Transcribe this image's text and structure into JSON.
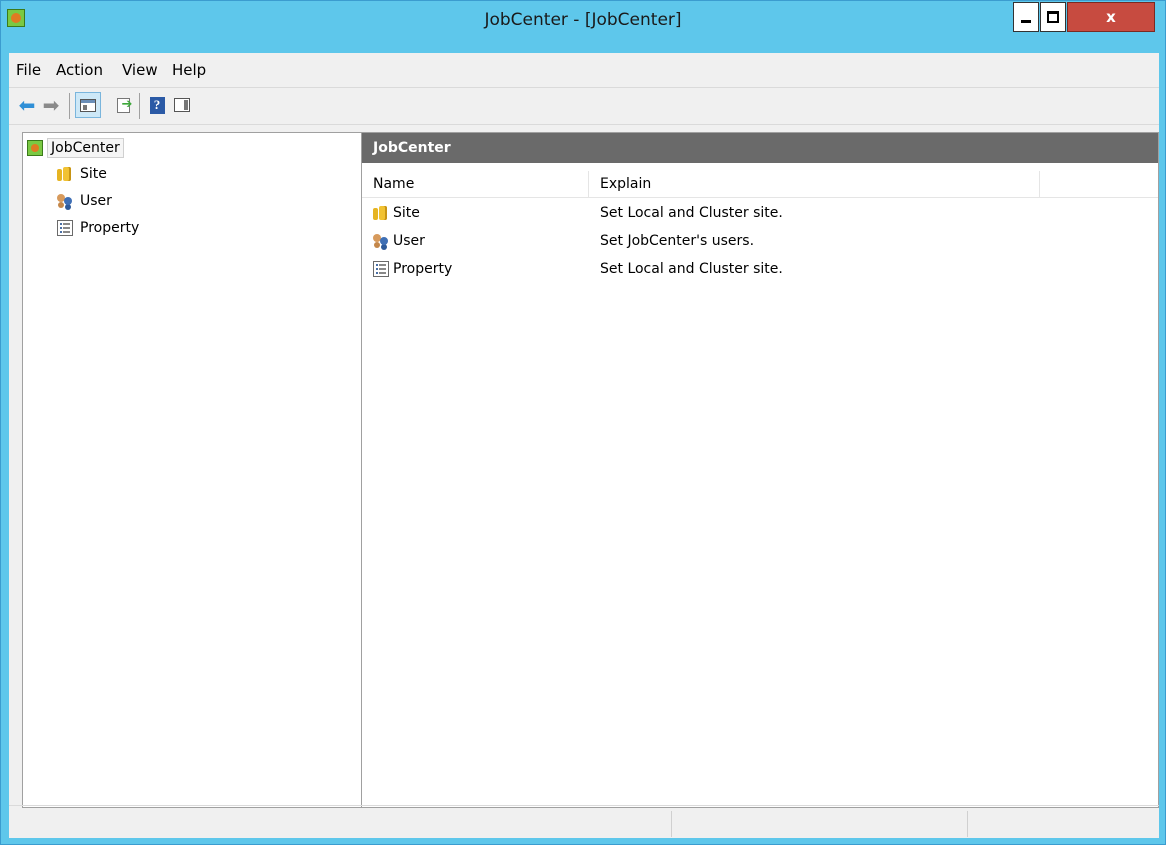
{
  "window": {
    "title": "JobCenter - [JobCenter]",
    "close_label": "x"
  },
  "menu": {
    "items": [
      "File",
      "Action",
      "View",
      "Help"
    ]
  },
  "toolbar": {
    "icons": [
      "back-icon",
      "forward-icon",
      "show-hide-console-tree-icon",
      "export-list-icon",
      "help-icon",
      "show-hide-action-pane-icon"
    ]
  },
  "tree": {
    "root": "JobCenter",
    "children": [
      "Site",
      "User",
      "Property"
    ]
  },
  "content": {
    "header": "JobCenter",
    "columns": [
      "Name",
      "Explain"
    ],
    "rows": [
      {
        "name": "Site",
        "explain": "Set Local and Cluster site.",
        "icon": "site-icon"
      },
      {
        "name": "User",
        "explain": "Set JobCenter's users.",
        "icon": "user-icon"
      },
      {
        "name": "Property",
        "explain": "Set Local and Cluster site.",
        "icon": "property-icon"
      }
    ]
  },
  "colors": {
    "titlebar": "#5ec7eb",
    "close_button": "#c74b40",
    "content_header": "#6a6a6a"
  }
}
